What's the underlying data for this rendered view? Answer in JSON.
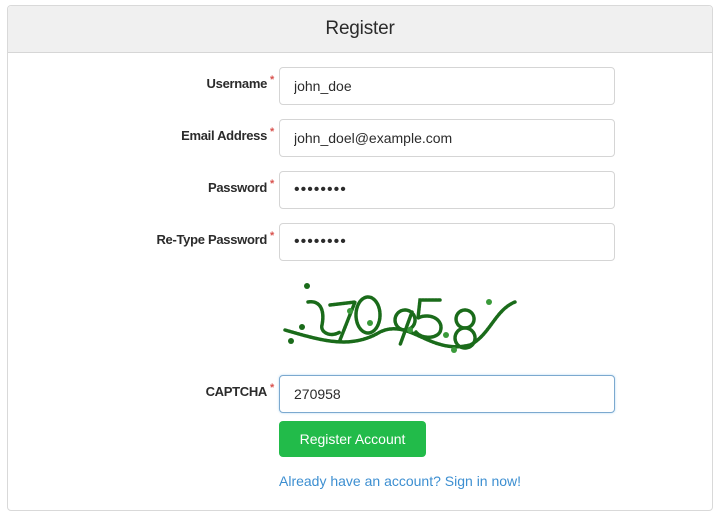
{
  "header": {
    "title": "Register"
  },
  "form": {
    "fields": [
      {
        "label": "Username",
        "required_marker": "*",
        "value": "john_doe"
      },
      {
        "label": "Email Address",
        "required_marker": "*",
        "value": "john_doel@example.com"
      },
      {
        "label": "Password",
        "required_marker": "*",
        "value": "••••••••"
      },
      {
        "label": "Re-Type Password",
        "required_marker": "*",
        "value": "••••••••"
      }
    ],
    "captcha": {
      "label": "CAPTCHA",
      "required_marker": "*",
      "image_text": "270958",
      "value": "270958"
    },
    "submit_label": "Register Account",
    "signin_link": "Already have an account? Sign in now!"
  },
  "colors": {
    "accent_button": "#22bb4a",
    "link": "#3d8fd1",
    "required": "#d9534f",
    "captcha_ink": "#1a6b1a"
  }
}
